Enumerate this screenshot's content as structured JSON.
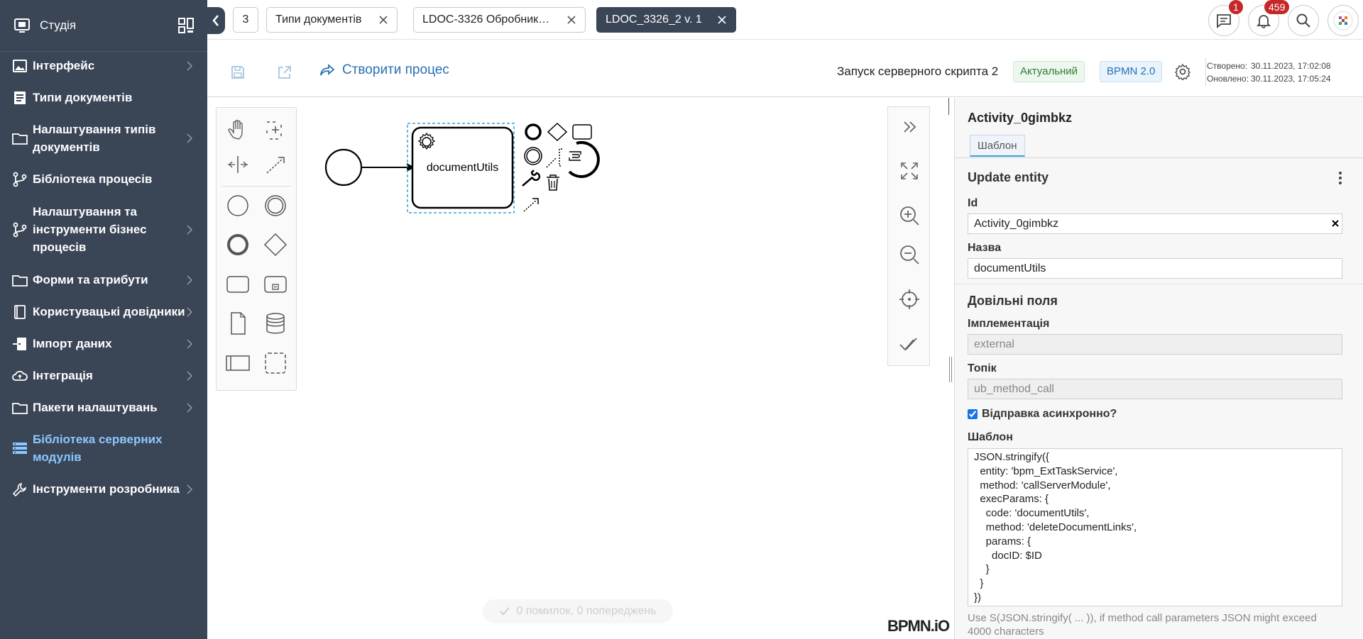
{
  "sidebar": {
    "title": "Студія",
    "items": [
      {
        "label": "Інтерфейс",
        "icon": "image-icon",
        "chevron": true
      },
      {
        "label": "Типи документів",
        "icon": "document-icon",
        "chevron": false
      },
      {
        "label": "Налаштування типів документів",
        "icon": "folder-icon",
        "chevron": true
      },
      {
        "label": "Бібліотека процесів",
        "icon": "branch-icon",
        "chevron": false
      },
      {
        "label": "Налаштування та інструменти бізнес процесів",
        "icon": "branch-icon",
        "chevron": true
      },
      {
        "label": "Форми та атрибути",
        "icon": "folder-icon",
        "chevron": true
      },
      {
        "label": "Користувацькі довідники",
        "icon": "book-icon",
        "chevron": true
      },
      {
        "label": "Імпорт даних",
        "icon": "import-icon",
        "chevron": true
      },
      {
        "label": "Інтеграція",
        "icon": "cloud-icon",
        "chevron": true
      },
      {
        "label": "Пакети налаштувань",
        "icon": "folder-icon",
        "chevron": true
      },
      {
        "label": "Бібліотека серверних модулів",
        "icon": "server-icon",
        "chevron": false,
        "active": true
      },
      {
        "label": "Інструменти розробника",
        "icon": "tools-icon",
        "chevron": true
      }
    ]
  },
  "topbar": {
    "tab_count": "3",
    "tabs": [
      {
        "label": "Типи документів"
      },
      {
        "label": "LDOC-3326 Обробник…"
      },
      {
        "label": "LDOC_3326_2 v. 1",
        "current": true
      }
    ],
    "messages_badge": "1",
    "notifications_badge": "459"
  },
  "toolbar": {
    "create_process": "Створити процес",
    "process_name": "Запуск серверного скрипта 2",
    "status_badge": "Актуальний",
    "bpmn_badge": "BPMN 2.0",
    "created_label": "Створено:",
    "created_value": "30.11.2023, 17:02:08",
    "updated_label": "Оновлено:",
    "updated_value": "30.11.2023, 17:05:24"
  },
  "canvas": {
    "task_label": "documentUtils",
    "status_text": "0 помилок, 0 попереджень",
    "watermark": "BPMN.iO"
  },
  "props": {
    "element_id_title": "Activity_0gimbkz",
    "tab_template": "Шаблон",
    "section_title": "Update entity",
    "id_label": "Id",
    "id_value": "Activity_0gimbkz",
    "name_label": "Назва",
    "name_value": "documentUtils",
    "custom_fields": "Довільні поля",
    "impl_label": "Імплементація",
    "impl_value": "external",
    "topic_label": "Топік",
    "topic_value": "ub_method_call",
    "async_label": "Відправка асинхронно?",
    "async_checked": true,
    "template_label": "Шаблон",
    "template_value": "JSON.stringify({\n  entity: 'bpm_ExtTaskService',\n  method: 'callServerModule',\n  execParams: {\n    code: 'documentUtils',\n    method: 'deleteDocumentLinks',\n    params: {\n      docID: $ID\n    }\n  }\n})",
    "template_hint": "Use S(JSON.stringify( ... )), if method call parameters JSON might exceed 4000 characters"
  },
  "colors": {
    "sidebar_bg": "#3a4556",
    "active_item": "#8cc8ff",
    "link_blue": "#2a6fb5",
    "badge_red": "#c62828",
    "status_green": "#2e7d32"
  }
}
